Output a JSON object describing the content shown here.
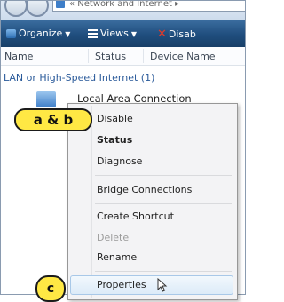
{
  "address_bar": {
    "text": "« Network and Internet ▸"
  },
  "toolbar": {
    "organize_label": "Organize",
    "views_label": "Views",
    "disable_label": "Disab"
  },
  "columns": {
    "name": "Name",
    "status": "Status",
    "device_name": "Device Name"
  },
  "group": {
    "label": "LAN or High-Speed Internet (1)"
  },
  "connection": {
    "label": "Local Area Connection"
  },
  "context_menu": {
    "items": [
      {
        "label": "Disable"
      },
      {
        "label": "Status"
      },
      {
        "label": "Diagnose"
      },
      {
        "label": "Bridge Connections"
      },
      {
        "label": "Create Shortcut"
      },
      {
        "label": "Delete"
      },
      {
        "label": "Rename"
      },
      {
        "label": "Properties"
      }
    ]
  },
  "callouts": {
    "ab": "a & b",
    "c": "c"
  },
  "colors": {
    "toolbar": "#1f4d7d",
    "callout_fill": "#ffe844",
    "group_text": "#2a5a9a",
    "disable_icon": "#e23a2a"
  },
  "icons": [
    "back-icon",
    "forward-icon",
    "organize-icon",
    "views-icon",
    "disable-icon",
    "network-connection-icon",
    "mouse-pointer-icon"
  ]
}
